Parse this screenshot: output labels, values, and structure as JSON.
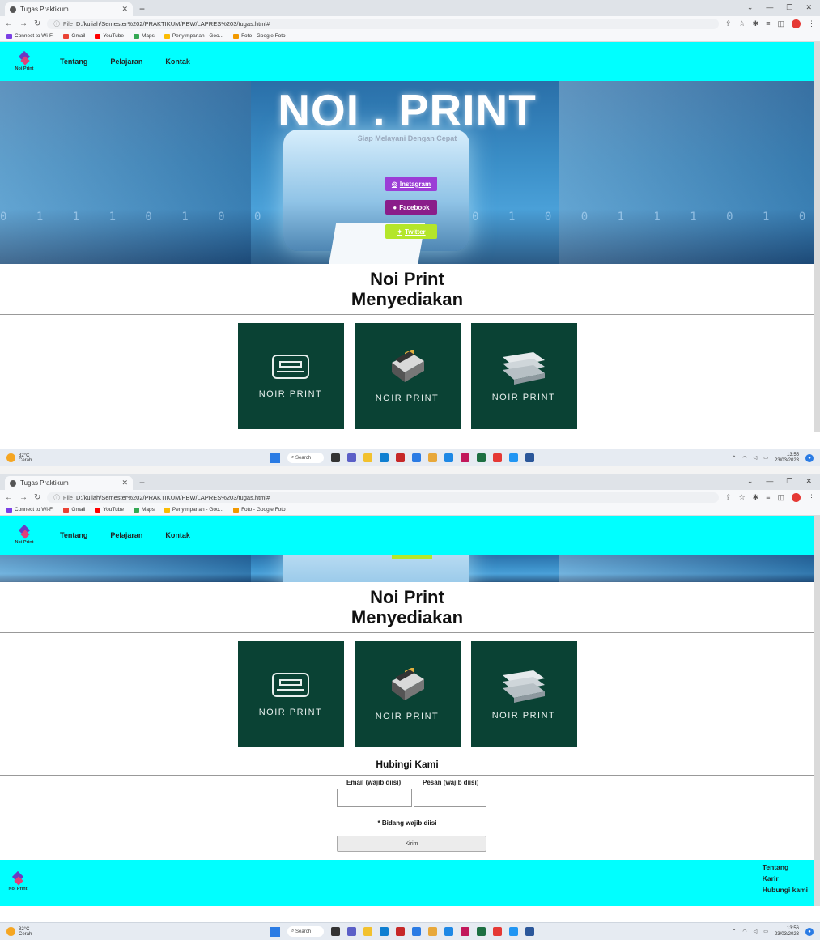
{
  "browser": {
    "tab_title": "Tugas Praktikum",
    "new_tab": "+",
    "url_prefix": "File",
    "url": "D:/kuliah/Semester%202/PRAKTIKUM/PBW/LAPRES%203/tugas.html#",
    "bookmarks": [
      {
        "label": "Connect to Wi-Fi",
        "color": "#7b3fe4"
      },
      {
        "label": "Gmail",
        "color": "#ea4335"
      },
      {
        "label": "YouTube",
        "color": "#ff0000"
      },
      {
        "label": "Maps",
        "color": "#34a853"
      },
      {
        "label": "Penyimpanan - Goo...",
        "color": "#fbbc04"
      },
      {
        "label": "Foto - Google Foto",
        "color": "#f29900"
      }
    ]
  },
  "nav": {
    "logo_text": "Noi Print",
    "links": [
      "Tentang",
      "Pelajaran",
      "Kontak"
    ]
  },
  "hero": {
    "title": "NOI . PRINT",
    "subtitle": "Siap Melayani Dengan Cepat",
    "binary": "0 1 1 1 0 1 0 0 1 0 1 1 1 0 1 0 0 1 1 1 0 1 0 0 1 0 1 1",
    "social": {
      "instagram": "Instagram",
      "facebook": "Facebook",
      "twitter": "Twitter"
    }
  },
  "section": {
    "title_line1": "Noi Print",
    "title_line2": "Menyediakan",
    "cards": [
      {
        "label": "NOIR PRINT",
        "icon": "printer-outline-icon"
      },
      {
        "label": "NOIR PRINT",
        "icon": "photocopier-icon"
      },
      {
        "label": "NOIR PRINT",
        "icon": "paper-stack-icon"
      }
    ]
  },
  "contact": {
    "title": "Hubingi Kami",
    "email_label": "Email (wajib diisi)",
    "message_label": "Pesan (wajib diisi)",
    "required_note": "* Bidang wajib diisi",
    "submit": "Kirim"
  },
  "footer": {
    "logo_text": "Noi Print",
    "links": [
      "Tentang",
      "Karir",
      "Hubungi kami"
    ]
  },
  "taskbar": {
    "temp": "32°C",
    "weather": "Cerah",
    "search": "Search",
    "time1": "13:55",
    "time2": "13:56",
    "date": "23/03/2023"
  }
}
